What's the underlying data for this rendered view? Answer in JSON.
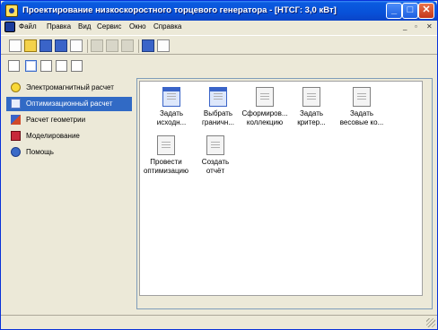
{
  "window": {
    "title": "Проектирование низкоскоростного торцевого генератора - [НТСГ: 3,0 кВт]",
    "minimize_label": "_",
    "maximize_label": "□",
    "close_label": "✕"
  },
  "menubar": {
    "items": [
      "Файл",
      "Правка",
      "Вид",
      "Сервис",
      "Окно",
      "Справка"
    ],
    "mdi_controls": [
      "_",
      "▫",
      "✕"
    ]
  },
  "toolbar": {
    "buttons": [
      "new-document",
      "open-folder",
      "save",
      "save-all",
      "print",
      "cut",
      "copy",
      "paste",
      "refresh",
      "tools"
    ]
  },
  "viewbar": {
    "buttons": [
      "home-view",
      "large-icons",
      "small-icons",
      "list",
      "details"
    ]
  },
  "sidebar": {
    "items": [
      {
        "label": "Электромагнитный расчет",
        "icon": "lightbulb-icon"
      },
      {
        "label": "Оптимизационный расчет",
        "icon": "optimization-icon"
      },
      {
        "label": "Расчет геометрии",
        "icon": "geometry-icon"
      },
      {
        "label": "Моделирование",
        "icon": "cube-icon"
      },
      {
        "label": "Помощь",
        "icon": "help-icon"
      }
    ],
    "selected_index": 1
  },
  "content": {
    "items": [
      {
        "line1": "Задать",
        "line2": "исходн...",
        "style": "blue"
      },
      {
        "line1": "Выбрать",
        "line2": "граничн...",
        "style": "blue"
      },
      {
        "line1": "Сформиров...",
        "line2": "коллекцию",
        "style": "plain"
      },
      {
        "line1": "Задать",
        "line2": "критер...",
        "style": "plain"
      },
      {
        "line1": "Задать",
        "line2": "весовые ко...",
        "style": "plain"
      },
      {
        "line1": "Провести",
        "line2": "оптимизацию",
        "style": "plain"
      },
      {
        "line1": "Создать",
        "line2": "отчёт",
        "style": "plain"
      }
    ]
  },
  "colors": {
    "titlebar": "#0851d8",
    "selection": "#316ac5",
    "window_face": "#ece9d8"
  }
}
